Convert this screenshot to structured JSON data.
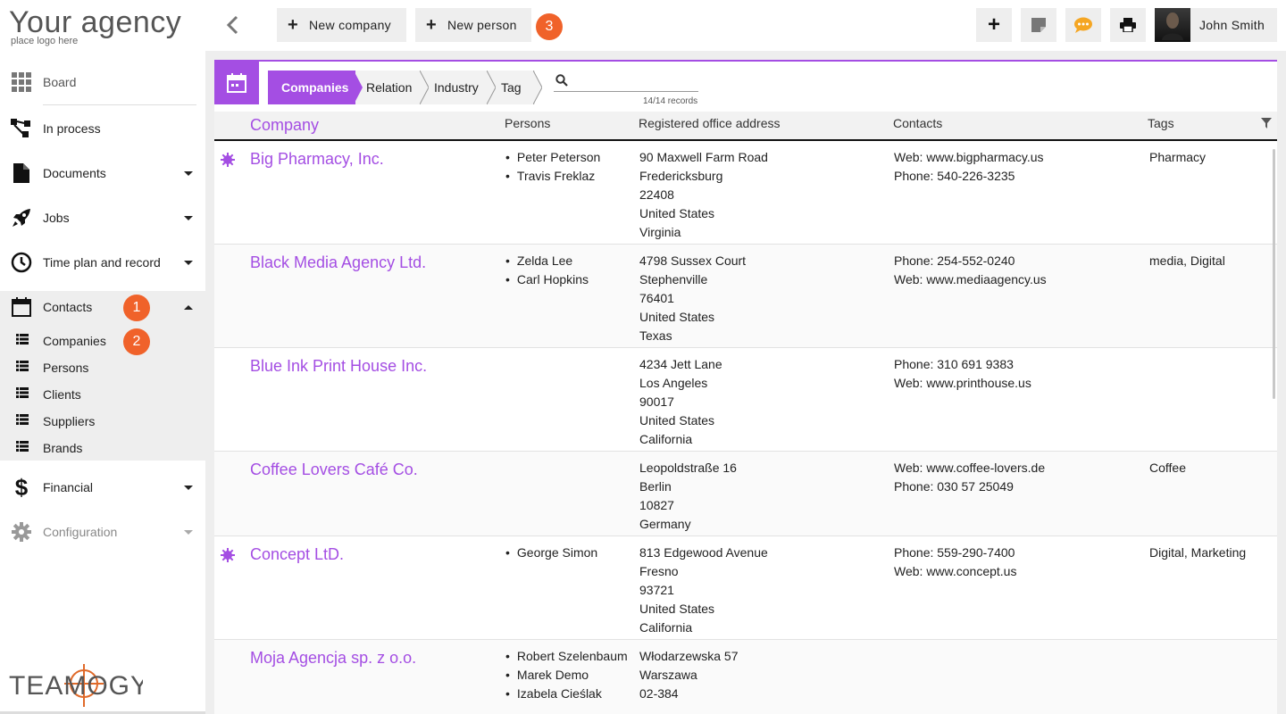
{
  "logo": {
    "title": "Your agency",
    "subtitle": "place logo here",
    "brand": "TEAMOGY"
  },
  "sidebar": {
    "items": [
      {
        "label": "Board",
        "icon": "grid-icon"
      },
      {
        "label": "In process",
        "icon": "flow-icon"
      },
      {
        "label": "Documents",
        "icon": "document-icon"
      },
      {
        "label": "Jobs",
        "icon": "rocket-icon"
      },
      {
        "label": "Time plan and record",
        "icon": "clock-icon"
      },
      {
        "label": "Contacts",
        "icon": "calendar-icon"
      },
      {
        "label": "Financial",
        "icon": "dollar-icon"
      },
      {
        "label": "Configuration",
        "icon": "gear-icon"
      }
    ],
    "subitems": [
      {
        "label": "Companies",
        "icon": "list-icon"
      },
      {
        "label": "Persons",
        "icon": "list-icon"
      },
      {
        "label": "Clients",
        "icon": "list-icon"
      },
      {
        "label": "Suppliers",
        "icon": "list-icon"
      },
      {
        "label": "Brands",
        "icon": "list-icon"
      }
    ],
    "badges": [
      "1",
      "2"
    ]
  },
  "topbar": {
    "new_company": "New company",
    "new_person": "New person",
    "badge": "3",
    "user_name": "John Smith"
  },
  "breadcrumbs": [
    "Companies",
    "Relation",
    "Industry",
    "Tag"
  ],
  "search": {
    "placeholder": "",
    "records": "14/14 records"
  },
  "table": {
    "headers": {
      "company": "Company",
      "persons": "Persons",
      "address": "Registered office address",
      "contacts": "Contacts",
      "tags": "Tags"
    },
    "rows": [
      {
        "name": "Big Pharmacy, Inc.",
        "starred": true,
        "persons": [
          "Peter Peterson",
          "Travis Freklaz"
        ],
        "address": [
          "90 Maxwell Farm Road",
          "Fredericksburg",
          "22408",
          "United States",
          "Virginia"
        ],
        "contacts": [
          "Web: www.bigpharmacy.us",
          "Phone: 540-226-3235"
        ],
        "tags": "Pharmacy"
      },
      {
        "name": "Black Media Agency Ltd.",
        "starred": false,
        "persons": [
          "Zelda Lee",
          "Carl Hopkins"
        ],
        "address": [
          "4798 Sussex Court",
          "Stephenville",
          "76401",
          "United States",
          "Texas"
        ],
        "contacts": [
          "Phone: 254-552-0240",
          "Web: www.mediaagency.us"
        ],
        "tags": "media, Digital"
      },
      {
        "name": "Blue Ink Print House Inc.",
        "starred": false,
        "persons": [],
        "address": [
          "4234 Jett Lane",
          "Los Angeles",
          "90017",
          "United States",
          "California"
        ],
        "contacts": [
          "Phone: 310 691 9383",
          "Web: www.printhouse.us"
        ],
        "tags": ""
      },
      {
        "name": "Coffee Lovers Café Co.",
        "starred": false,
        "persons": [],
        "address": [
          "Leopoldstraße 16",
          "Berlin",
          "10827",
          "Germany"
        ],
        "contacts": [
          "Web: www.coffee-lovers.de",
          "Phone: 030 57 25049"
        ],
        "tags": "Coffee"
      },
      {
        "name": "Concept LtD.",
        "starred": true,
        "persons": [
          "George Simon"
        ],
        "address": [
          "813 Edgewood Avenue",
          "Fresno",
          "93721",
          "United States",
          "California"
        ],
        "contacts": [
          "Phone: 559-290-7400",
          "Web: www.concept.us"
        ],
        "tags": "Digital, Marketing"
      },
      {
        "name": "Moja Agencja sp. z o.o.",
        "starred": false,
        "persons": [
          "Robert Szelenbaum",
          "Marek Demo",
          "Izabela Cieślak"
        ],
        "address": [
          "Włodarzewska 57",
          "Warszawa",
          "02-384"
        ],
        "contacts": [],
        "tags": ""
      }
    ]
  },
  "colors": {
    "accent": "#a44ee3",
    "badge": "#f0622a",
    "chat": "#f5a623"
  }
}
